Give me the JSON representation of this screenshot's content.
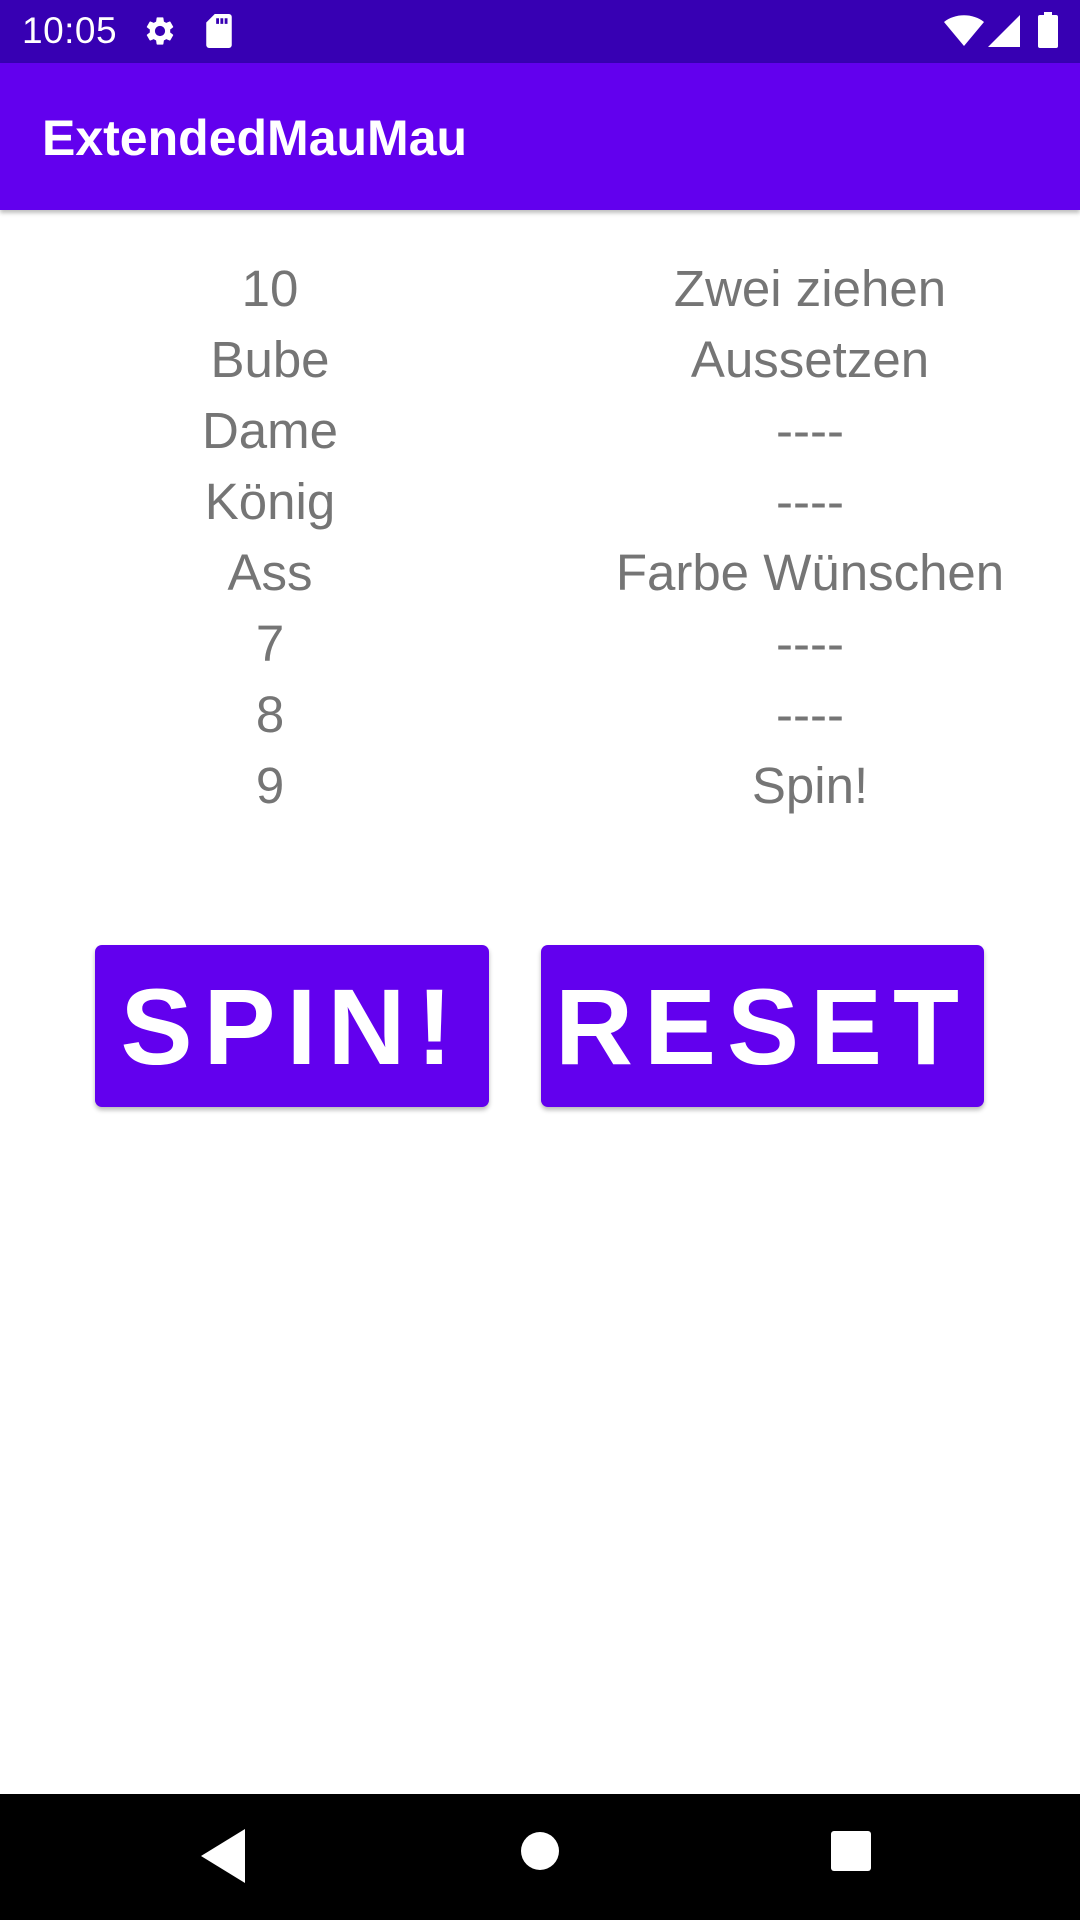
{
  "status_bar": {
    "time": "10:05",
    "icons": [
      "gear-icon",
      "sd-card-icon",
      "wifi-icon",
      "signal-icon",
      "battery-icon"
    ]
  },
  "app_bar": {
    "title": "ExtendedMauMau"
  },
  "rules": {
    "cards": [
      "10",
      "Bube",
      "Dame",
      "König",
      "Ass",
      "7",
      "8",
      "9"
    ],
    "effects": [
      "Zwei ziehen",
      "Aussetzen",
      "----",
      "----",
      "Farbe Wünschen",
      "----",
      "----",
      "Spin!"
    ]
  },
  "buttons": {
    "spin_label": "SPIN!",
    "reset_label": "RESET"
  },
  "nav_bar": {
    "icons": [
      "back-icon",
      "home-icon",
      "recents-icon"
    ]
  },
  "colors": {
    "status_bar": "#3700b3",
    "primary": "#6200ee",
    "list_text": "#757575"
  }
}
